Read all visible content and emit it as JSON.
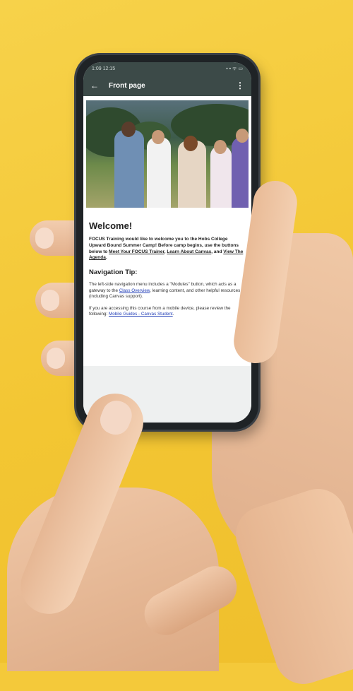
{
  "status": {
    "time": "1:09 12:15",
    "icons": "▪ ▪ ᯤ ▭"
  },
  "appbar": {
    "title": "Front page",
    "back_icon": "arrow-left-icon",
    "menu_icon": "kebab-icon"
  },
  "welcome": {
    "heading": "Welcome!",
    "para_start": "FOCUS Training would like to welcome you to the Hobs College Upward Bound Summer Camp! Before camp begins, use the buttons below to ",
    "link_trainer": "Meet Your FOCUS Trainer",
    "sep1": ", ",
    "link_canvas": "Learn About Canvas",
    "sep2": ", and ",
    "link_agenda": "View The Agenda",
    "para_end": "."
  },
  "tip": {
    "heading": "Navigation Tip:",
    "p1_start": "The left-side navigation menu includes a \"Modules\" button, which acts as a gateway to the ",
    "p1_link": "Class Overview",
    "p1_end": ", learning content, and other helpful resources (including Canvas support).",
    "p2_start": "If you are accessing this course from a mobile device, please review the following: ",
    "p2_link": "Mobile Guides - Canvas Student",
    "p2_end": "."
  },
  "colors": {
    "background": "#f4c93a",
    "appbar": "#3c4a48",
    "link": "#2440b8"
  }
}
